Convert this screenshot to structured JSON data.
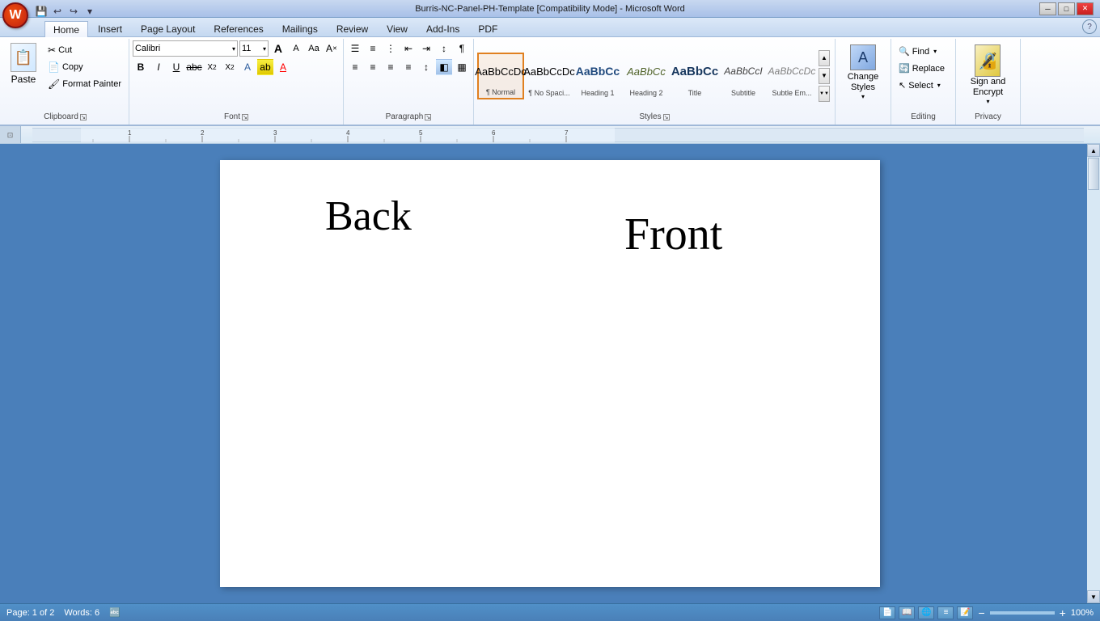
{
  "titlebar": {
    "title": "Burris-NC-Panel-PH-Template [Compatibility Mode] - Microsoft Word",
    "minimize": "─",
    "maximize": "□",
    "close": "✕"
  },
  "quickaccess": {
    "save": "💾",
    "undo": "↩",
    "redo": "↪",
    "dropdown": "▾"
  },
  "tabs": [
    {
      "label": "Home",
      "active": true
    },
    {
      "label": "Insert",
      "active": false
    },
    {
      "label": "Page Layout",
      "active": false
    },
    {
      "label": "References",
      "active": false
    },
    {
      "label": "Mailings",
      "active": false
    },
    {
      "label": "Review",
      "active": false
    },
    {
      "label": "View",
      "active": false
    },
    {
      "label": "Add-Ins",
      "active": false
    },
    {
      "label": "PDF",
      "active": false
    }
  ],
  "groups": {
    "clipboard": {
      "label": "Clipboard",
      "paste_label": "Paste",
      "cut_label": "Cut",
      "copy_label": "Copy",
      "format_painter_label": "Format Painter"
    },
    "font": {
      "label": "Font",
      "font_name": "Calibri",
      "font_size": "11",
      "bold": "B",
      "italic": "I",
      "underline": "U",
      "strikethrough": "abc",
      "subscript": "x₂",
      "superscript": "x²",
      "grow": "A",
      "shrink": "A",
      "clear": "A",
      "case": "Aa",
      "highlight": "ab",
      "color": "A"
    },
    "paragraph": {
      "label": "Paragraph"
    },
    "styles": {
      "label": "Styles",
      "items": [
        {
          "name": "Normal",
          "preview": "AaBbCcDc",
          "active": true
        },
        {
          "name": "No Spaci...",
          "preview": "AaBbCcDc",
          "active": false
        },
        {
          "name": "Heading 1",
          "preview": "AaBbCc",
          "active": false
        },
        {
          "name": "Heading 2",
          "preview": "AaBbCc",
          "active": false
        },
        {
          "name": "Title",
          "preview": "AaBbCc",
          "active": false
        },
        {
          "name": "Subtitle",
          "preview": "AaBbCcI",
          "active": false
        },
        {
          "name": "Subtle Em...",
          "preview": "AaBbCcDc",
          "active": false
        }
      ]
    },
    "change_styles": {
      "label": "Change\nStyles",
      "dropdown": "▾"
    },
    "editing": {
      "label": "Editing",
      "find_label": "Find",
      "replace_label": "Replace",
      "select_label": "Select"
    },
    "privacy": {
      "label": "Privacy",
      "sign_label": "Sign and\nEncrypt",
      "dropdown": "▾"
    }
  },
  "document": {
    "text_back": "Back",
    "text_front": "Front"
  },
  "statusbar": {
    "page_info": "Page: 1 of 2",
    "words_info": "Words: 6",
    "language_icon": "🔤",
    "zoom_percent": "100%"
  }
}
